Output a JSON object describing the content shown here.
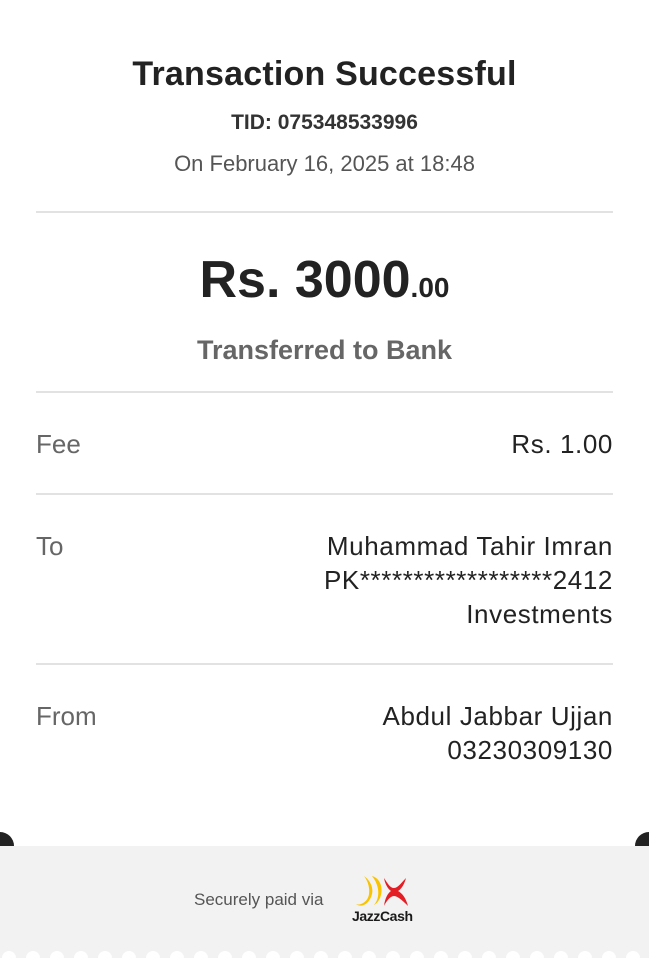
{
  "receipt": {
    "title": "Transaction Successful",
    "tid_label": "TID:",
    "tid_value": "075348533996",
    "datetime": "On February 16, 2025 at 18:48",
    "amount_main": "Rs. 3000",
    "amount_decimals": ".00",
    "transfer_type": "Transferred to Bank"
  },
  "details": {
    "fee": {
      "label": "Fee",
      "value": "Rs. 1.00"
    },
    "to": {
      "label": "To",
      "name": "Muhammad Tahir Imran",
      "account": "PK******************2412",
      "bank": "Investments"
    },
    "from": {
      "label": "From",
      "name": "Abdul Jabbar Ujjan",
      "account": "03230309130"
    }
  },
  "footer": {
    "secure_text": "Securely paid via",
    "brand_name": "JazzCash",
    "brand_colors": {
      "yellow": "#F9C300",
      "red": "#E31E24",
      "dark": "#1A1A1A"
    }
  }
}
